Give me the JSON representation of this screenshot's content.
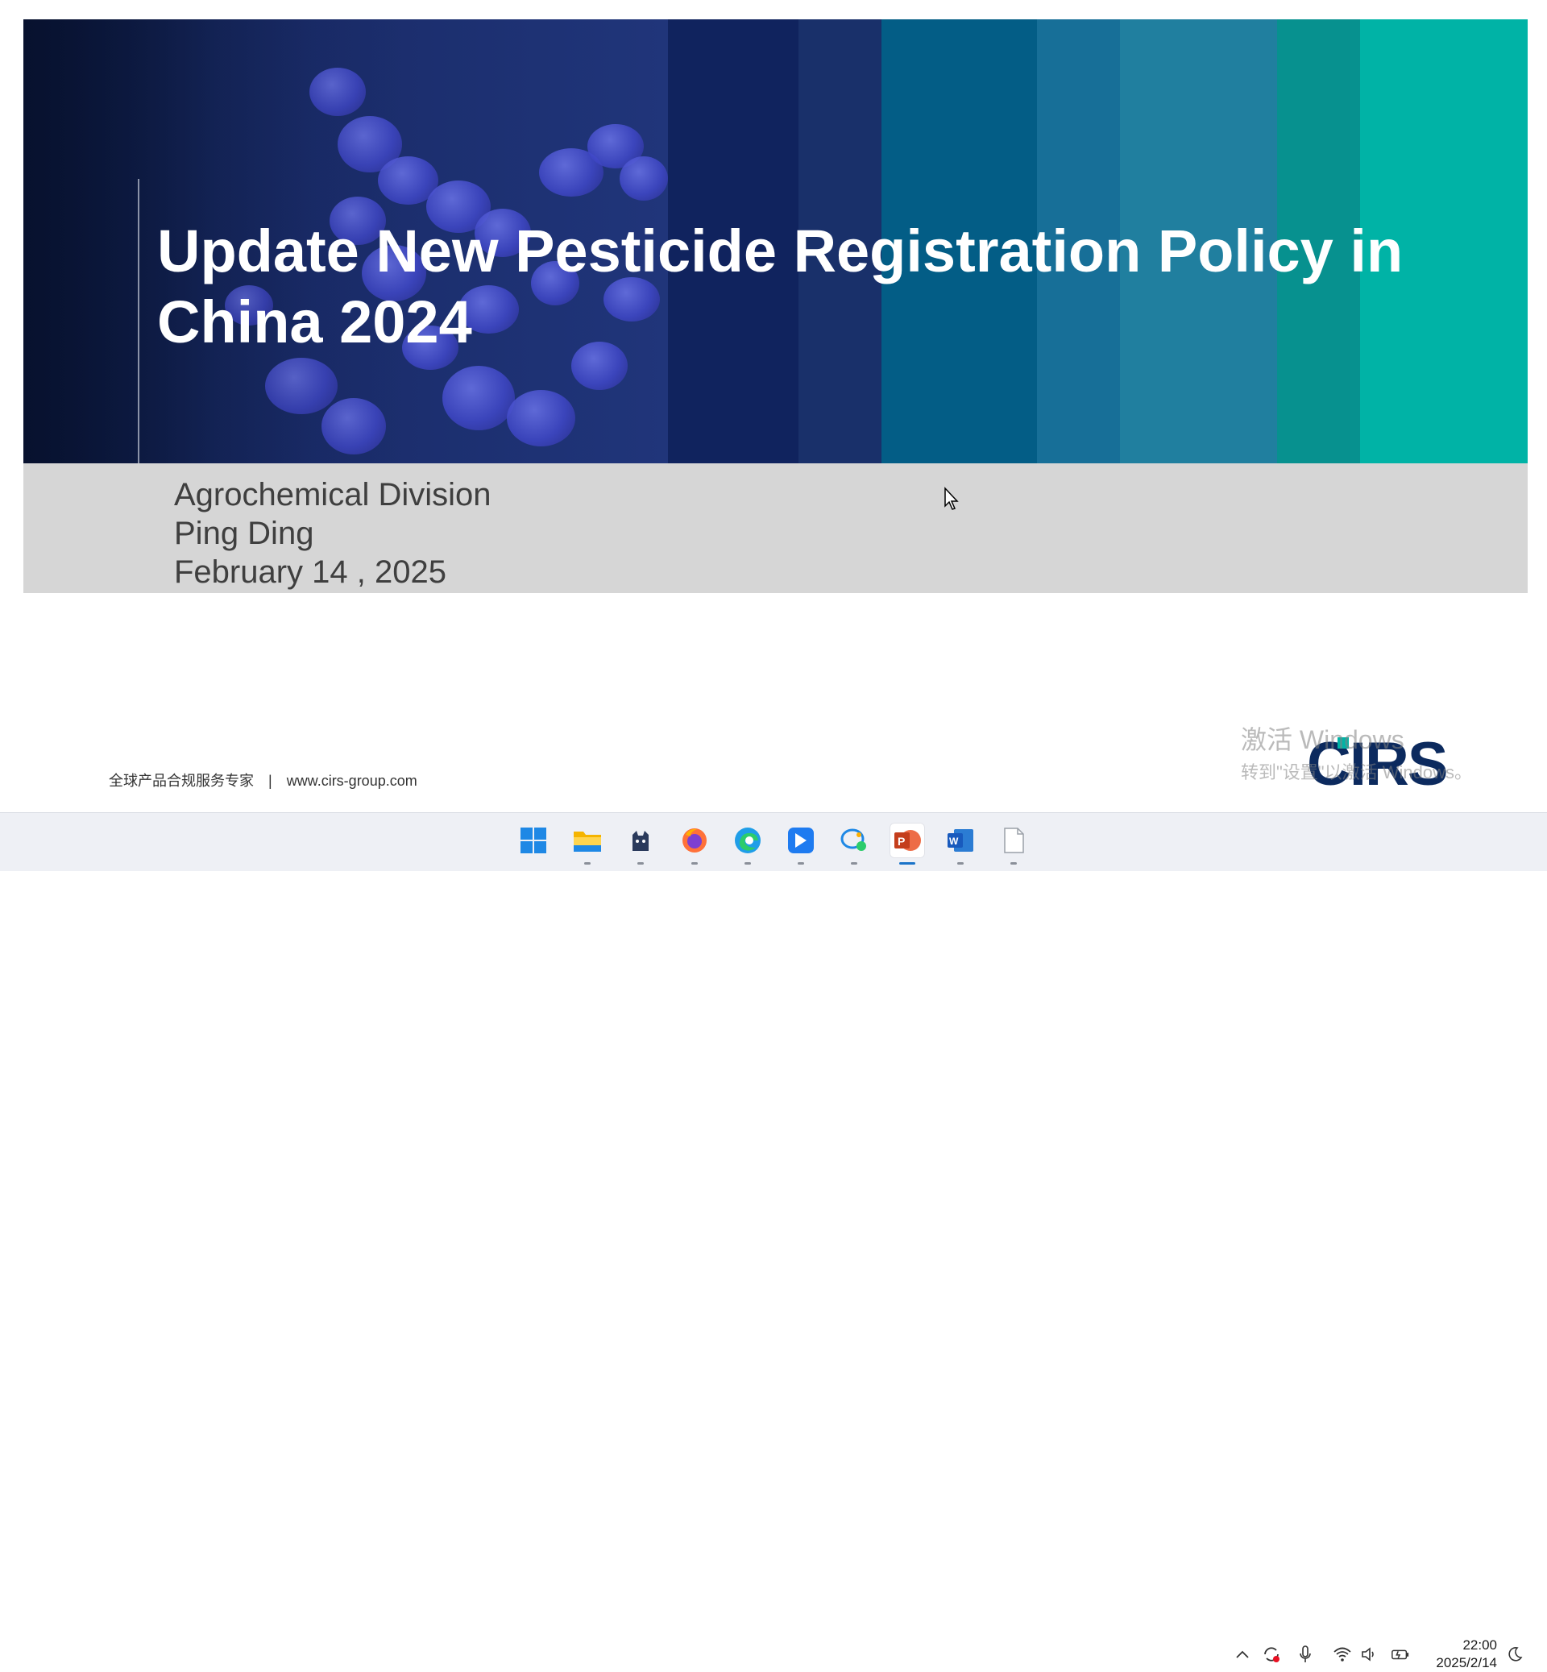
{
  "slide": {
    "title": "Update New Pesticide Registration Policy in China 2024",
    "subtitle_lines": [
      "Agrochemical Division",
      "Ping Ding",
      "February 14 , 2025"
    ],
    "footer_tagline": "全球产品合规服务专家",
    "footer_separator": "|",
    "footer_url": "www.cirs-group.com",
    "logo_text": "CIRS"
  },
  "watermark": {
    "line1": "激活 Windows",
    "line2": "转到\"设置\"以激活 Windows。"
  },
  "taskbar": {
    "apps": [
      {
        "name": "start",
        "icon": "windows-logo-icon"
      },
      {
        "name": "file-explorer",
        "icon": "folder-icon"
      },
      {
        "name": "app-cat",
        "icon": "cat-app-icon"
      },
      {
        "name": "firefox",
        "icon": "firefox-icon"
      },
      {
        "name": "edge",
        "icon": "edge-icon"
      },
      {
        "name": "feishu",
        "icon": "feishu-icon"
      },
      {
        "name": "chat",
        "icon": "chat-icon"
      },
      {
        "name": "powerpoint",
        "icon": "powerpoint-icon",
        "active": true
      },
      {
        "name": "word",
        "icon": "word-icon"
      },
      {
        "name": "document",
        "icon": "blank-document-icon"
      }
    ],
    "tray": [
      "chevron-up-icon",
      "sync-icon",
      "microphone-icon",
      "wifi-icon",
      "speaker-icon",
      "battery-icon",
      "moon-icon"
    ],
    "time": "22:00",
    "date": "2025/2/14"
  },
  "colors": {
    "hero_dark": "#14255a",
    "teal_light": "#00b3a6",
    "band_gray": "#d6d6d6",
    "logo_navy": "#0c2a5e"
  }
}
